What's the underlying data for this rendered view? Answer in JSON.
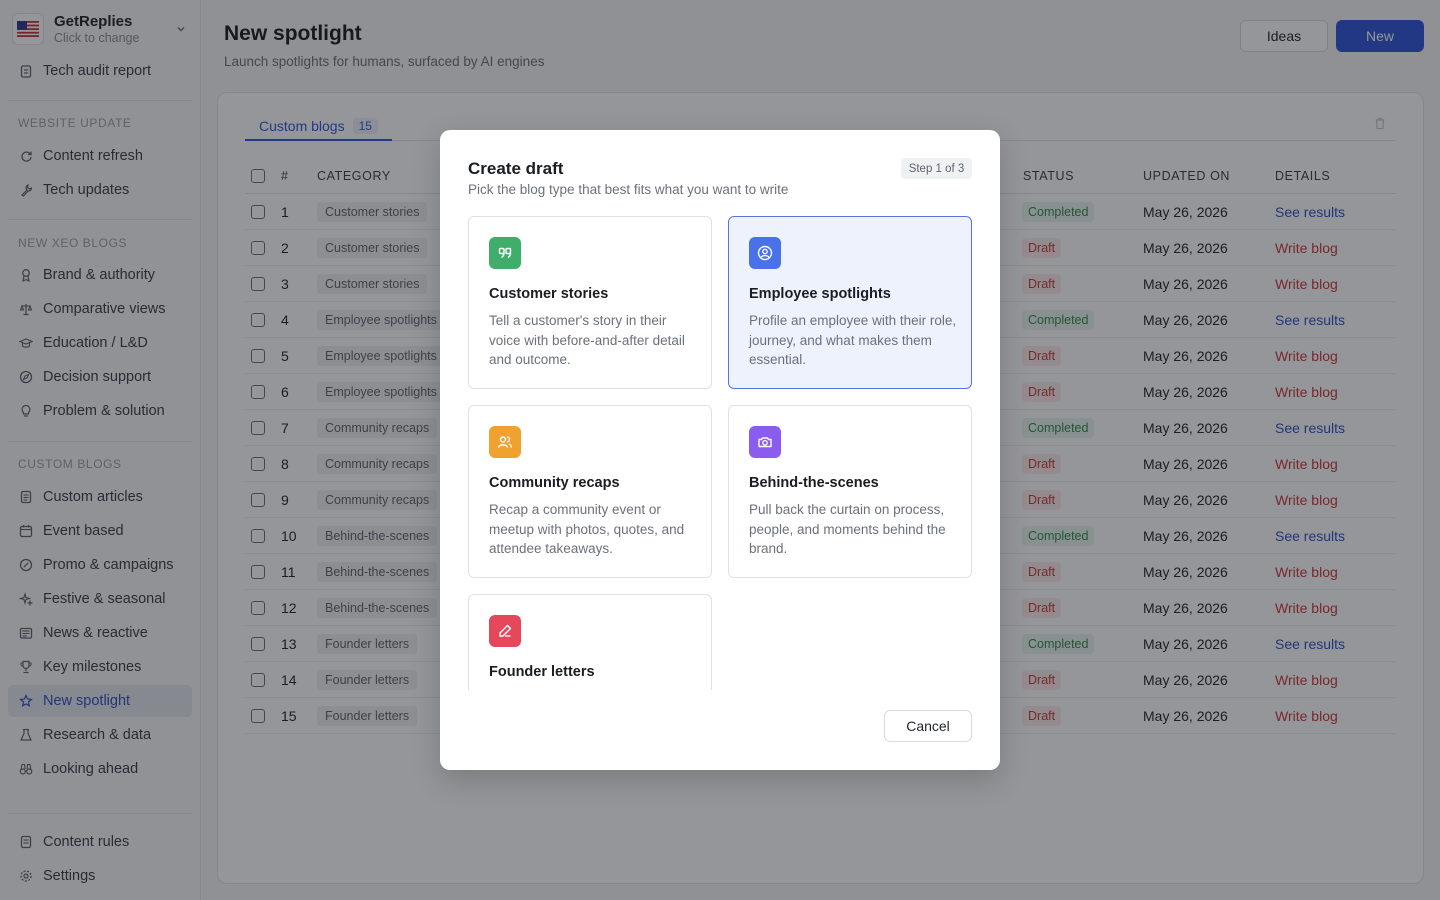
{
  "workspace": {
    "name": "GetReplies",
    "sub": "Click to change",
    "flag": "us-flag-icon"
  },
  "sidebar": {
    "top_item": "Tech audit report",
    "sections": [
      {
        "title": "WEBSITE UPDATE",
        "items": [
          "Content refresh",
          "Tech updates"
        ]
      },
      {
        "title": "NEW XEO BLOGS",
        "items": [
          "Brand & authority",
          "Comparative views",
          "Education / L&D",
          "Decision support",
          "Problem & solution"
        ]
      },
      {
        "title": "CUSTOM BLOGS",
        "items": [
          "Custom articles",
          "Event based",
          "Promo & campaigns",
          "Festive & seasonal",
          "News & reactive",
          "Key milestones",
          "New spotlight",
          "Research & data",
          "Looking ahead"
        ]
      }
    ],
    "bottom_items": [
      "Content rules",
      "Settings"
    ],
    "active": "New spotlight"
  },
  "header": {
    "title": "New spotlight",
    "subtitle": "Launch spotlights for humans, surfaced by AI engines",
    "ideas_label": "Ideas",
    "new_label": "New"
  },
  "tabs": [
    {
      "label": "Custom blogs",
      "count": "15"
    }
  ],
  "table": {
    "columns": [
      "#",
      "CATEGORY",
      "STATUS",
      "UPDATED ON",
      "DETAILS"
    ],
    "rows": [
      {
        "num": "1",
        "category": "Customer stories",
        "status": "Completed",
        "updated": "May 26, 2026",
        "details": "See results"
      },
      {
        "num": "2",
        "category": "Customer stories",
        "status": "Draft",
        "updated": "May 26, 2026",
        "details": "Write blog"
      },
      {
        "num": "3",
        "category": "Customer stories",
        "status": "Draft",
        "updated": "May 26, 2026",
        "details": "Write blog"
      },
      {
        "num": "4",
        "category": "Employee spotlights",
        "status": "Completed",
        "updated": "May 26, 2026",
        "details": "See results"
      },
      {
        "num": "5",
        "category": "Employee spotlights",
        "status": "Draft",
        "updated": "May 26, 2026",
        "details": "Write blog"
      },
      {
        "num": "6",
        "category": "Employee spotlights",
        "status": "Draft",
        "updated": "May 26, 2026",
        "details": "Write blog"
      },
      {
        "num": "7",
        "category": "Community recaps",
        "status": "Completed",
        "updated": "May 26, 2026",
        "details": "See results"
      },
      {
        "num": "8",
        "category": "Community recaps",
        "status": "Draft",
        "updated": "May 26, 2026",
        "details": "Write blog"
      },
      {
        "num": "9",
        "category": "Community recaps",
        "status": "Draft",
        "updated": "May 26, 2026",
        "details": "Write blog"
      },
      {
        "num": "10",
        "category": "Behind-the-scenes",
        "status": "Completed",
        "updated": "May 26, 2026",
        "details": "See results"
      },
      {
        "num": "11",
        "category": "Behind-the-scenes",
        "status": "Draft",
        "updated": "May 26, 2026",
        "details": "Write blog"
      },
      {
        "num": "12",
        "category": "Behind-the-scenes",
        "status": "Draft",
        "updated": "May 26, 2026",
        "details": "Write blog"
      },
      {
        "num": "13",
        "category": "Founder letters",
        "status": "Completed",
        "updated": "May 26, 2026",
        "details": "See results"
      },
      {
        "num": "14",
        "category": "Founder letters",
        "status": "Draft",
        "updated": "May 26, 2026",
        "details": "Write blog"
      },
      {
        "num": "15",
        "category": "Founder letters",
        "status": "Draft",
        "updated": "May 26, 2026",
        "details": "Write blog"
      }
    ]
  },
  "modal": {
    "title": "Create draft",
    "subtitle": "Pick the blog type that best fits what you want to write",
    "step": "Step 1 of 3",
    "cards": [
      {
        "title": "Customer stories",
        "desc": "Tell a customer's story in their voice with before-and-after detail and outcome.",
        "icon": "quote-icon",
        "color": "#3fae6a",
        "selected": false
      },
      {
        "title": "Employee spotlights",
        "desc": "Profile an employee with their role, journey, and what makes them essential.",
        "icon": "user-circle-icon",
        "color": "#4a72e8",
        "selected": true
      },
      {
        "title": "Community recaps",
        "desc": "Recap a community event or meetup with photos, quotes, and attendee takeaways.",
        "icon": "users-icon",
        "color": "#f0a230",
        "selected": false
      },
      {
        "title": "Behind-the-scenes",
        "desc": "Pull back the curtain on process, people, and moments behind the brand.",
        "icon": "camera-icon",
        "color": "#8b5cf0",
        "selected": false
      },
      {
        "title": "Founder letters",
        "desc": "",
        "icon": "pen-icon",
        "color": "#e5485a",
        "selected": false
      }
    ],
    "cancel_label": "Cancel"
  }
}
